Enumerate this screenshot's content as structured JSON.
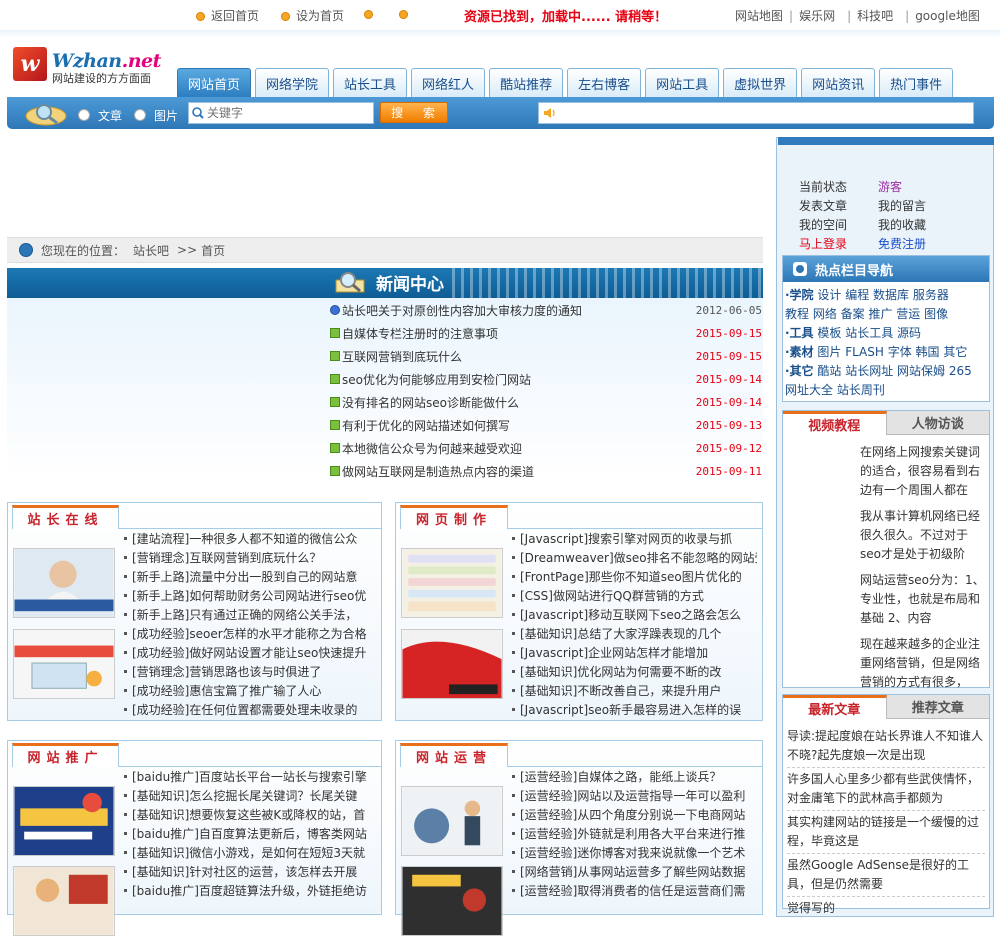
{
  "top": {
    "links_left": [
      "返回首页",
      "设为首页",
      "",
      ""
    ],
    "loading": "资源已找到，加载中...... 请稍等！",
    "links_right": [
      "网站地图",
      "娱乐网",
      "科技吧",
      "google地图"
    ]
  },
  "logo": {
    "brand": "Wzhan",
    "tld": ".net",
    "tagline": "网站建设的方方面面"
  },
  "nav": {
    "tabs": [
      "网站首页",
      "网络学院",
      "站长工具",
      "网络红人",
      "酷站推荐",
      "左右博客",
      "网站工具",
      "虚拟世界",
      "网站资讯",
      "热门事件"
    ]
  },
  "search": {
    "radio_article": "文章",
    "radio_image": "图片",
    "placeholder": "关键字",
    "button": "搜 索"
  },
  "location": {
    "label": "您现在的位置：",
    "site": "站长吧",
    "sep": ">>",
    "page": "首页"
  },
  "news": {
    "title": "新闻中心",
    "items": [
      {
        "title": "站长吧关于对原创性内容加大审核力度的通知",
        "date": "2012-06-05"
      },
      {
        "title": "自媒体专栏注册时的注意事项",
        "date": "2015-09-15"
      },
      {
        "title": "互联网营销到底玩什么",
        "date": "2015-09-15"
      },
      {
        "title": "seo优化为何能够应用到安检门网站",
        "date": "2015-09-14"
      },
      {
        "title": "没有排名的网站seo诊断能做什么",
        "date": "2015-09-14"
      },
      {
        "title": "有利于优化的网站描述如何撰写",
        "date": "2015-09-13"
      },
      {
        "title": "本地微信公众号为何越来越受欢迎",
        "date": "2015-09-12"
      },
      {
        "title": "做网站互联网是制造热点内容的渠道",
        "date": "2015-09-11"
      }
    ]
  },
  "panels": {
    "zhanzhang": {
      "title": "站长在线",
      "items": [
        "[建站流程]一种很多人都不知道的微信公众",
        "[营销理念]互联网营销到底玩什么？",
        "[新手上路]流量中分出一股到自己的网站意",
        "[新手上路]如何帮助财务公司网站进行seo优",
        "[新手上路]只有通过正确的网络公关手法，",
        "[成功经验]seoer怎样的水平才能称之为合格",
        "[成功经验]做好网站设置才能让seo快速提升",
        "[营销理念]营销思路也该与时俱进了",
        "[成功经验]惠信宝篇了推广输了人心",
        "[成功经验]在任何位置都需要处理未收录的"
      ]
    },
    "wangye": {
      "title": "网页制作",
      "items": [
        "[Javascript]搜索引擎对网页的收录与抓",
        "[Dreamweaver]做seo排名不能忽略的网站受",
        "[FrontPage]那些你不知道seo图片优化的",
        "[CSS]做网站进行QQ群营销的方式",
        "[Javascript]移动互联网下seo之路会怎么",
        "[基础知识]总结了大家浮躁表现的几个",
        "[Javascript]企业网站怎样才能增加",
        "[基础知识]优化网站为何需要不断的改",
        "[基础知识]不断改善自己，来提升用户",
        "[Javascript]seo新手最容易进入怎样的误"
      ]
    },
    "tuiguang": {
      "title": "网站推广",
      "items": [
        "[baidu推广]百度站长平台一站长与搜索引擎",
        "[基础知识]怎么挖掘长尾关键词？长尾关键",
        "[基础知识]想要恢复这些被K或降权的站，首",
        "[baidu推广]自百度算法更新后，博客类网站",
        "[基础知识]微信小游戏，是如何在短短3天就",
        "[基础知识]针对社区的运营，该怎样去开展",
        "[baidu推广]百度超链算法升级，外链拒绝访"
      ]
    },
    "yunying": {
      "title": "网站运营",
      "items": [
        "[运营经验]自媒体之路，能纸上谈兵？",
        "[运营经验]网站以及运营指导一年可以盈利",
        "[运营经验]从四个角度分别说一下电商网站",
        "[运营经验]外链就是利用各大平台来进行推",
        "[运营经验]迷你博客对我来说就像一个艺术",
        "[网络营销]从事网站运营多了解些网站数据",
        "[运营经验]取得消费者的信任是运营商们需"
      ]
    }
  },
  "sidebar": {
    "status": [
      [
        "当前状态",
        "游客"
      ],
      [
        "发表文章",
        "我的留言"
      ],
      [
        "我的空间",
        "我的收藏"
      ],
      [
        "马上登录",
        "免费注册"
      ]
    ],
    "hot_nav": {
      "title": "热点栏目导航",
      "lines": [
        {
          "head": "·学院",
          "rest": " 设计 编程 数据库 服务器"
        },
        {
          "head": "",
          "rest": "教程 网络 备案 推广 营运 图像"
        },
        {
          "head": "·工具",
          "rest": " 模板 站长工具 源码"
        },
        {
          "head": "·素材",
          "rest": " 图片 FLASH 字体 韩国 其它"
        },
        {
          "head": "·其它",
          "rest": " 酷站 站长网址 网站保姆 265"
        },
        {
          "head": "",
          "rest": "网址大全 站长周刊"
        }
      ]
    },
    "video": {
      "tab_on": "视频教程",
      "tab_off": "人物访谈",
      "items": [
        "在网络上网搜索关键词的适合，很容易看到右边有一个周围人都在",
        "我从事计算机网络已经很久很久。不过对于seo才是处于初级阶",
        "网站运营seo分为：1、专业性，也就是布局和基础 2、内容",
        "现在越来越多的企业注重网络营销，但是网络营销的方式有很多，"
      ]
    },
    "latest": {
      "tab_on": "最新文章",
      "tab_off": "推荐文章",
      "items": [
        "导读:提起度娘在站长界谁人不知谁人不晓?起先度娘一次是出现",
        "许多国人心里多少都有些武侠情怀，对金庸笔下的武林高手都颇为",
        "  其实构建网站的链接是一个缓慢的过程，毕竟这是",
        "虽然Google AdSense是很好的工具，但是仍然需要",
        "  觉得写的"
      ]
    }
  }
}
